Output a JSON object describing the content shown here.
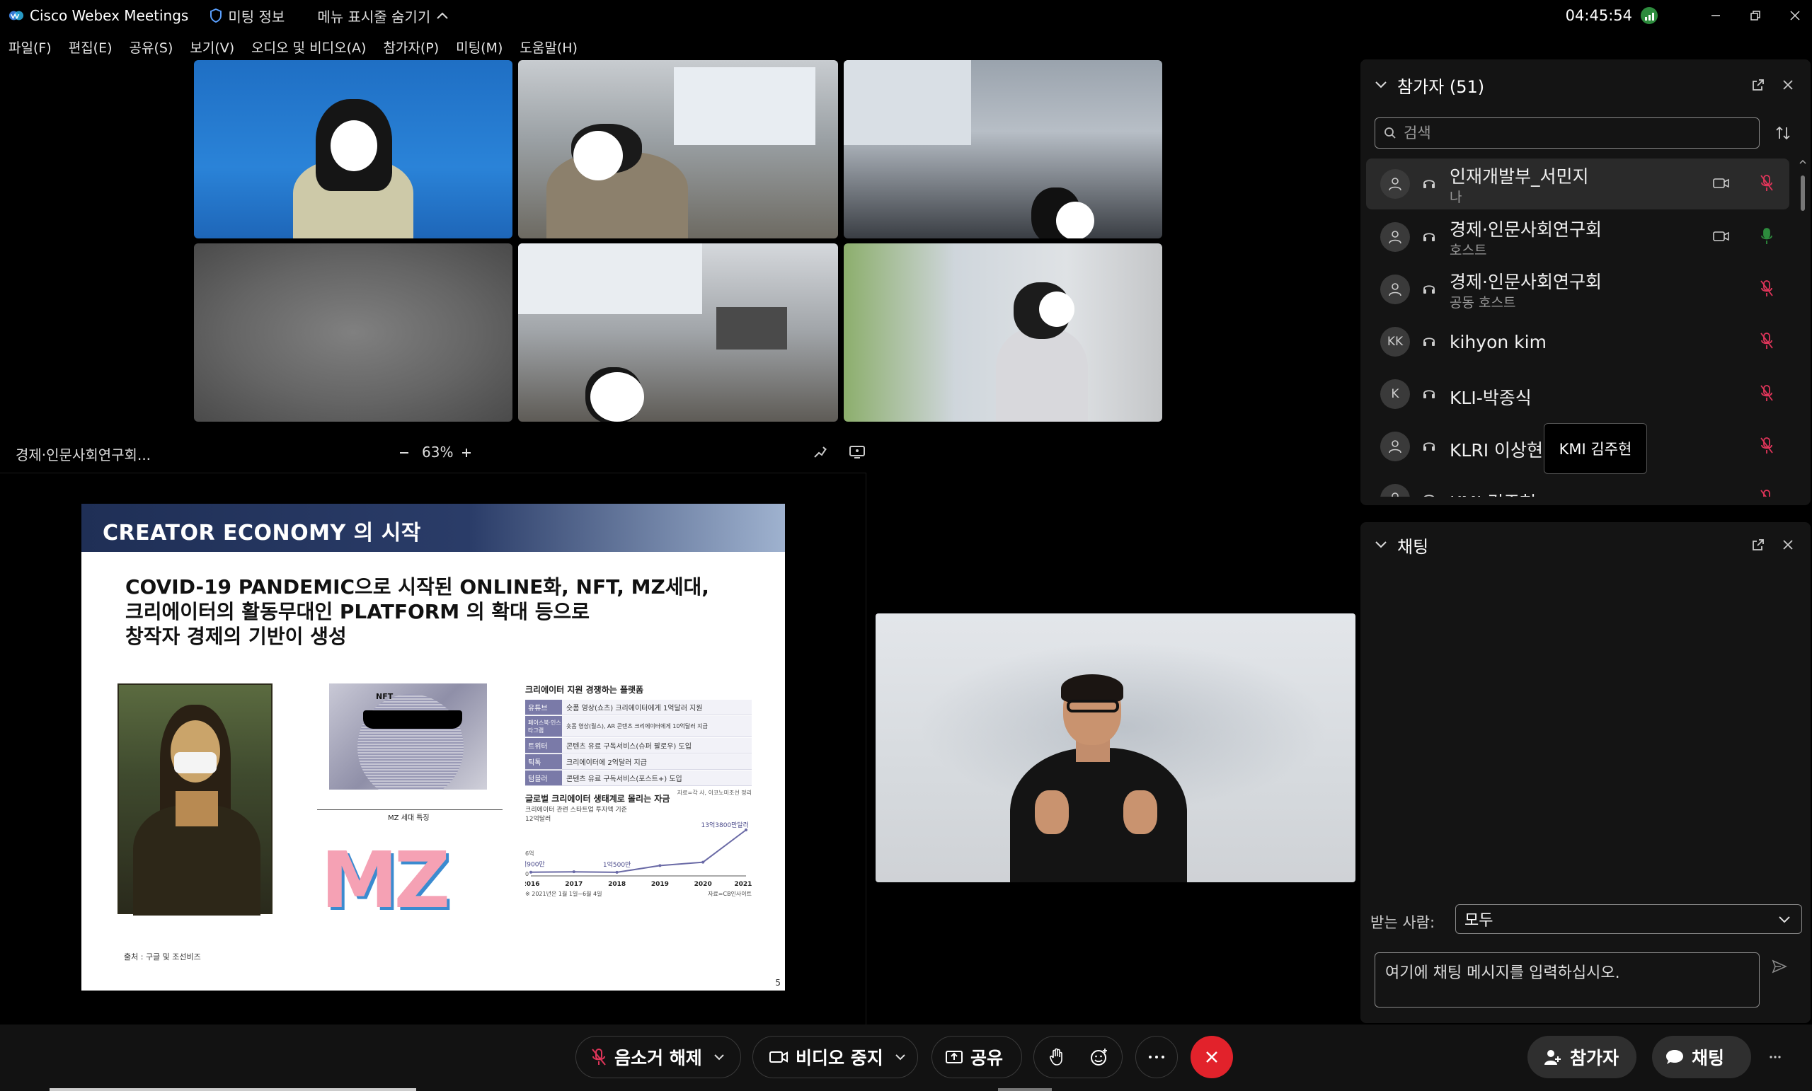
{
  "titlebar": {
    "app_name": "Cisco Webex Meetings",
    "meeting_info": "미팅 정보",
    "hide_menu": "메뉴 표시줄 숨기기",
    "clock": "04:45:54"
  },
  "menubar": {
    "items": [
      "파일(F)",
      "편집(E)",
      "공유(S)",
      "보기(V)",
      "오디오 및 비디오(A)",
      "참가자(P)",
      "미팅(M)",
      "도움말(H)"
    ]
  },
  "share": {
    "presenter": "경제·인문사회연구회...",
    "zoom": "63%"
  },
  "slide": {
    "title": "CREATOR ECONOMY 의 시작",
    "body_lines": [
      "COVID-19 PANDEMIC으로 시작된 ONLINE화, NFT, MZ세대,",
      "크리에이터의 활동무대인 PLATFORM 의 확대 등으로",
      "창작자 경제의 기반이 생성"
    ],
    "table_title": "크리에이터 지원 경쟁하는 플랫폼",
    "table_rows": [
      {
        "k": "유튜브",
        "v": "숏폼 영상(쇼츠) 크리에이터에게 1억달러 지원"
      },
      {
        "k": "페이스북·인스타그램",
        "v": "숏폼 영상(릴스), AR 콘텐츠 크리에이터에게 10억달러 지급"
      },
      {
        "k": "트위터",
        "v": "콘텐츠 유료 구독서비스(슈퍼 팔로우) 도입"
      },
      {
        "k": "틱톡",
        "v": "크리에이터에 2억달러 지급"
      },
      {
        "k": "텀블러",
        "v": "콘텐츠 유료 구독서비스(포스트+) 도입"
      }
    ],
    "table_source": "자료=각 사, 이코노미조선 정리",
    "chart_title": "글로벌 크리에이터 생태계로 몰리는 자금",
    "chart_sub": "크리에이터 관련 스타트업 투자액 기준",
    "chart_unit": "12억달러",
    "chart_zero": "0",
    "chart_six": "6억",
    "chart_label_2016": "1억900만",
    "chart_label_2018": "1억500만",
    "chart_label_2021": "13억3800만달러",
    "chart_note": "※ 2021년은 1월 1일~6월 4일",
    "chart_source": "자료=CB인사이트",
    "mz_label": "MZ 세대 특징",
    "nft_label": "NFT",
    "source_label": "출처 : 구글 및 조선비즈",
    "page_number": "5"
  },
  "chart_data": {
    "type": "line",
    "x": [
      "2016",
      "2017",
      "2018",
      "2019",
      "2020",
      "2021년"
    ],
    "series": [
      {
        "values": [
          1.09,
          1.2,
          1.05,
          3.0,
          4.0,
          13.38
        ]
      }
    ],
    "title": "글로벌 크리에이터 생태계로 몰리는 자금",
    "ylabel": "12억달러",
    "ylim": [
      0,
      14
    ]
  },
  "participants": {
    "title": "참가자 (51)",
    "search_placeholder": "검색",
    "tooltip": "KMI 김주현",
    "list": [
      {
        "name": "인재개발부_서민지",
        "role": "나",
        "avatar": "",
        "cam": true,
        "mic": "muted",
        "selected": true
      },
      {
        "name": "경제·인문사회연구회",
        "role": "호스트",
        "avatar": "",
        "cam": true,
        "mic": "active",
        "selected": false
      },
      {
        "name": "경제·인문사회연구회",
        "role": "공동 호스트",
        "avatar": "",
        "cam": false,
        "mic": "muted",
        "selected": false
      },
      {
        "name": "kihyon kim",
        "role": "",
        "avatar": "KK",
        "cam": false,
        "mic": "muted",
        "selected": false
      },
      {
        "name": "KLI-박종식",
        "role": "",
        "avatar": "K",
        "cam": false,
        "mic": "muted",
        "selected": false
      },
      {
        "name": "KLRI 이상현",
        "role": "",
        "avatar": "",
        "cam": false,
        "mic": "muted",
        "selected": false
      },
      {
        "name": "KMI 김주현",
        "role": "",
        "avatar": "",
        "cam": false,
        "mic": "muted",
        "selected": false
      }
    ]
  },
  "chat": {
    "title": "채팅",
    "recipient_label": "받는 사람:",
    "recipient_value": "모두",
    "input_placeholder": "여기에 채팅 메시지를 입력하십시오."
  },
  "controls": {
    "unmute": "음소거 해제",
    "stop_video": "비디오 중지",
    "share": "공유",
    "participants": "참가자",
    "chat": "채팅"
  },
  "colors": {
    "end_call": "#e2222b",
    "active_mic": "#2d8b3d",
    "muted_mic": "#e0355a"
  }
}
